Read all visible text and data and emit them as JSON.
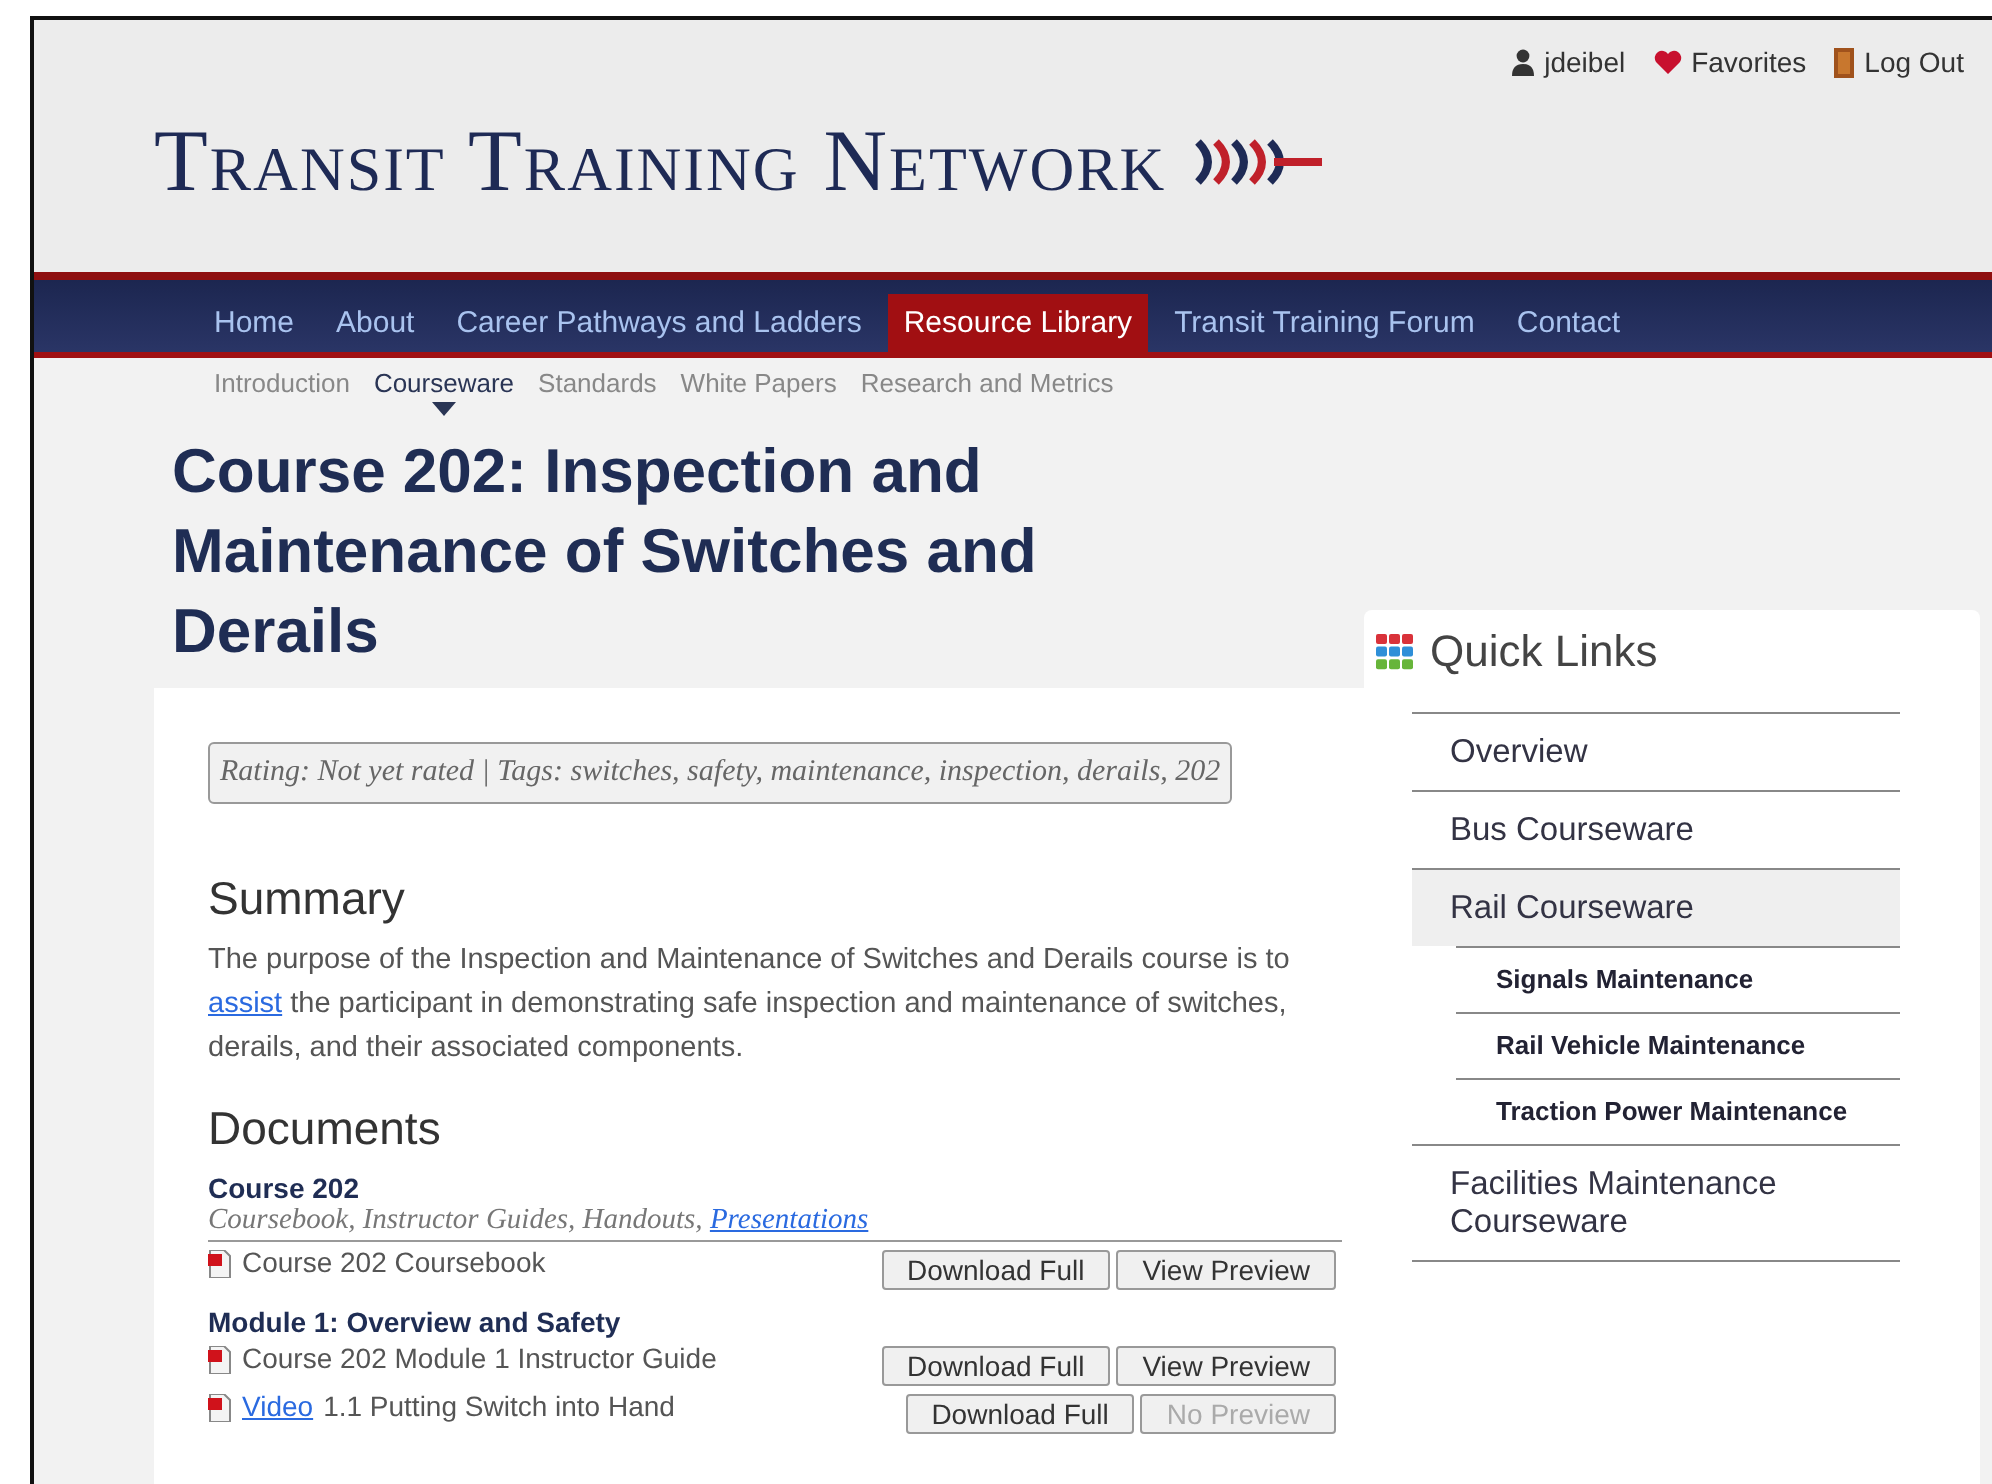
{
  "user_menu": [
    {
      "kind": "user",
      "label": "jdeibel"
    },
    {
      "kind": "favorites",
      "label": "Favorites"
    },
    {
      "kind": "logout",
      "label": "Log Out"
    }
  ],
  "site_title": "Transit Training Network",
  "nav": [
    {
      "label": "Home",
      "selected": false
    },
    {
      "label": "About",
      "selected": false
    },
    {
      "label": "Career Pathways and Ladders",
      "selected": false
    },
    {
      "label": "Resource Library",
      "selected": true
    },
    {
      "label": "Transit Training Forum",
      "selected": false
    },
    {
      "label": "Contact",
      "selected": false
    }
  ],
  "subnav": [
    {
      "label": "Introduction",
      "selected": false
    },
    {
      "label": "Courseware",
      "selected": true
    },
    {
      "label": "Standards",
      "selected": false
    },
    {
      "label": "White Papers",
      "selected": false
    },
    {
      "label": "Research and Metrics",
      "selected": false
    }
  ],
  "page_title": "Course 202: Inspection and Maintenance of Switches and Derails",
  "meta": "Rating: Not yet rated | Tags: switches, safety, maintenance, inspection, derails, 202",
  "summary": {
    "heading": "Summary",
    "before": "The purpose of the Inspection and Maintenance of Switches and Derails course is to",
    "link": "assist",
    "after": "the participant in demonstrating safe inspection and maintenance of switches, derails, and their associated components."
  },
  "documents": {
    "heading": "Documents",
    "groups": [
      {
        "title": "Course 202",
        "subtitle": "Coursebook, Instructor Guides, Handouts,",
        "subtitle_link": "Presentations",
        "rows": [
          {
            "text": "Course 202 Coursebook",
            "buttons": [
              {
                "label": "Download Full",
                "disabled": false
              },
              {
                "label": "View Preview",
                "disabled": false
              }
            ]
          }
        ]
      },
      {
        "title": "Module 1: Overview and Safety",
        "rows": [
          {
            "text": "Course 202 Module 1 Instructor Guide",
            "buttons": [
              {
                "label": "Download Full",
                "disabled": false
              },
              {
                "label": "View Preview",
                "disabled": false
              }
            ]
          },
          {
            "link": "Video",
            "text": "1.1 Putting Switch into Hand",
            "buttons": [
              {
                "label": "Download Full",
                "disabled": false
              },
              {
                "label": "No Preview",
                "disabled": true
              }
            ]
          }
        ]
      }
    ]
  },
  "quick_links": {
    "title": "Quick Links",
    "items": [
      {
        "label": "Overview",
        "selected": false
      },
      {
        "label": "Bus Courseware",
        "selected": false
      },
      {
        "label": "Rail Courseware",
        "selected": true,
        "children": [
          {
            "label": "Signals Maintenance"
          },
          {
            "label": "Rail Vehicle Maintenance"
          },
          {
            "label": "Traction Power Maintenance"
          }
        ]
      },
      {
        "label": "Facilities Maintenance Courseware",
        "selected": false
      }
    ]
  }
}
